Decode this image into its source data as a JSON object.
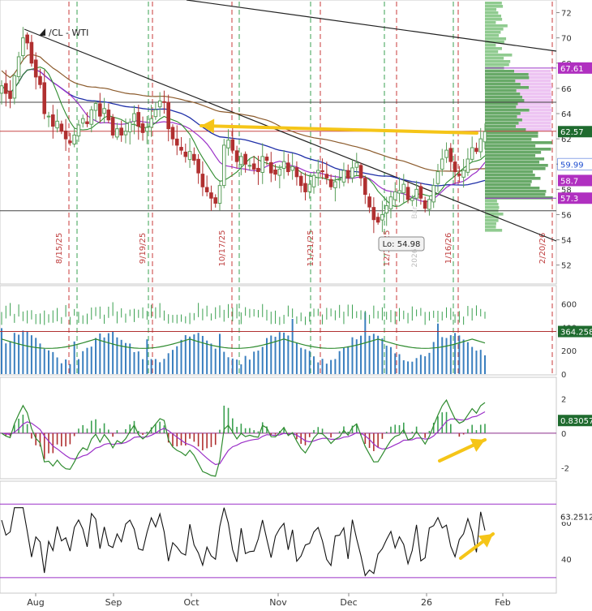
{
  "symbol": "/CL - WTI",
  "low_label": "Lo: 54.98",
  "year_marker": "2026",
  "sep_label": "Bar",
  "colors": {
    "up": "#5a9e5a",
    "down": "#b03030",
    "volume": "#3a7fbf",
    "green_line": "#2e8b2e",
    "purple_line": "#9b30c8",
    "blue_ma": "#1f2fa8",
    "brown_ma": "#8b5a2b",
    "yellow": "#f5c518",
    "price_tag": "#1f6b2f",
    "tag_blue": "#1f4fd0",
    "tag_purple": "#b030c0"
  },
  "chart_data": [
    {
      "type": "candlestick",
      "title": "/CL - WTI",
      "ylim": [
        50.5,
        73
      ],
      "y_ticks": [
        "72",
        "70",
        "68",
        "66",
        "64",
        "62",
        "60",
        "58",
        "56",
        "54",
        "52"
      ],
      "y_ticks_num": [
        72,
        70,
        68,
        66,
        64,
        62,
        60,
        58,
        56,
        54,
        52
      ],
      "x_months": [
        "Aug",
        "Sep",
        "Oct",
        "Nov",
        "Dec",
        "26",
        "Feb"
      ],
      "closes": [
        66.2,
        65.6,
        65.2,
        67.0,
        68.5,
        70.0,
        69.6,
        68.0,
        66.9,
        66.3,
        64.0,
        63.8,
        63.0,
        63.4,
        62.6,
        62.0,
        61.7,
        62.3,
        63.1,
        63.6,
        63.2,
        64.3,
        64.8,
        63.8,
        64.4,
        63.5,
        62.3,
        62.8,
        62.3,
        62.6,
        63.3,
        64.0,
        63.0,
        62.5,
        62.9,
        63.6,
        64.3,
        65.0,
        64.9,
        62.8,
        62.0,
        61.5,
        61.1,
        60.6,
        61.0,
        60.3,
        59.3,
        58.2,
        57.8,
        57.3,
        56.9,
        58.3,
        61.5,
        61.9,
        61.1,
        60.2,
        60.6,
        60.0,
        59.9,
        59.6,
        59.4,
        60.6,
        60.3,
        59.3,
        59.2,
        59.6,
        60.2,
        59.4,
        59.8,
        59.0,
        58.3,
        57.8,
        58.4,
        59.1,
        59.5,
        59.4,
        58.9,
        58.2,
        58.6,
        58.8,
        59.5,
        58.9,
        59.7,
        60.1,
        58.9,
        57.6,
        56.6,
        55.6,
        55.4,
        56.0,
        56.7,
        57.4,
        57.8,
        57.9,
        58.4,
        57.2,
        57.3,
        58.0,
        57.3,
        56.5,
        57.2,
        58.3,
        59.4,
        60.4,
        61.1,
        60.2,
        59.4,
        59.1,
        59.5,
        60.4,
        61.3,
        61.0,
        62.0,
        62.57
      ],
      "last_price": "62.57",
      "level_tags": [
        {
          "label": "67.61",
          "value": 67.61,
          "kind": "purple"
        },
        {
          "label": "62.57",
          "value": 62.57,
          "kind": "price"
        },
        {
          "label": "59.99",
          "value": 59.99,
          "kind": "blue"
        },
        {
          "label": "58.7",
          "value": 58.7,
          "kind": "purple"
        },
        {
          "label": "57.3",
          "value": 57.3,
          "kind": "purple"
        }
      ],
      "horizontal_levels": [
        64.9,
        62.6,
        56.3
      ],
      "event_dates": [
        "8/15/25",
        "9/19/25",
        "10/17/25",
        "11/21/25",
        "12/19/25",
        "1/16/26",
        "2/20/26"
      ],
      "low": 54.98
    },
    {
      "type": "bar",
      "title": "Volume",
      "ylim": [
        0,
        750
      ],
      "y_ticks": [
        "600",
        "400",
        "200",
        "0"
      ],
      "y_ticks_num": [
        600,
        400,
        200,
        0
      ],
      "last_value": "364.258"
    },
    {
      "type": "histogram+line",
      "title": "MACD",
      "ylim": [
        -2.6,
        3.2
      ],
      "y_ticks": [
        "2",
        "0",
        "-2"
      ],
      "y_ticks_num": [
        2,
        0,
        -2
      ],
      "last_value": "0.83057"
    },
    {
      "type": "line",
      "title": "RSI",
      "ylim": [
        22,
        82
      ],
      "y_ticks": [
        "60",
        "40"
      ],
      "y_ticks_num": [
        60,
        40
      ],
      "levels": [
        70,
        30
      ],
      "last_value": "63.2512"
    }
  ]
}
